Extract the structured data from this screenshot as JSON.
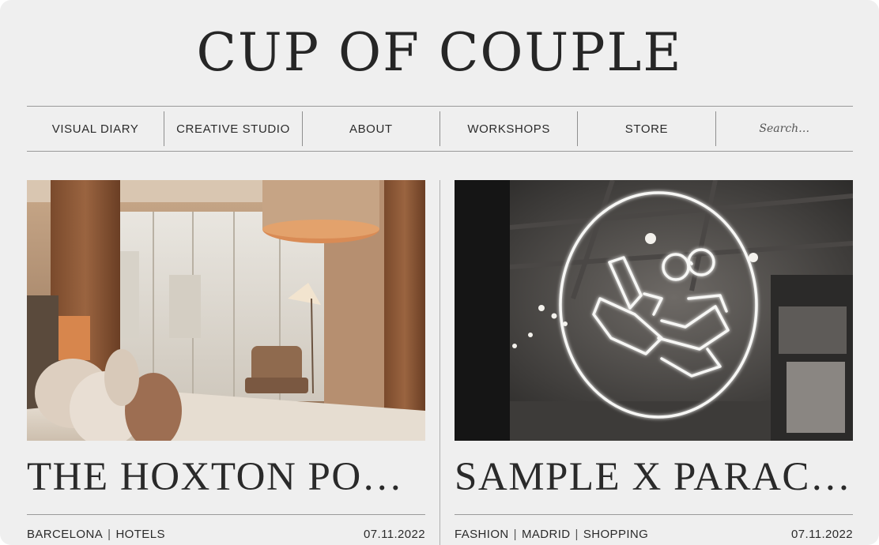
{
  "site": {
    "logo": "CUP OF COUPLE"
  },
  "nav": {
    "items": [
      "VISUAL DIARY",
      "CREATIVE STUDIO",
      "ABOUT",
      "WORKSHOPS",
      "STORE"
    ],
    "search_placeholder": "Search…"
  },
  "posts": [
    {
      "title": "THE HOXTON PO…",
      "tags": [
        "BARCELONA",
        "HOTELS"
      ],
      "separator": "|",
      "date": "07.11.2022",
      "image_subject": "hotel-bedroom-photo"
    },
    {
      "title": "SAMPLE X PARACIA…",
      "tags": [
        "FASHION",
        "MADRID",
        "SHOPPING"
      ],
      "separator": "|",
      "date": "07.11.2022",
      "image_subject": "neon-sign-shop-photo"
    }
  ],
  "colors": {
    "background": "#efefef",
    "text": "#2a2a2a",
    "rule": "#9a9a9a"
  }
}
